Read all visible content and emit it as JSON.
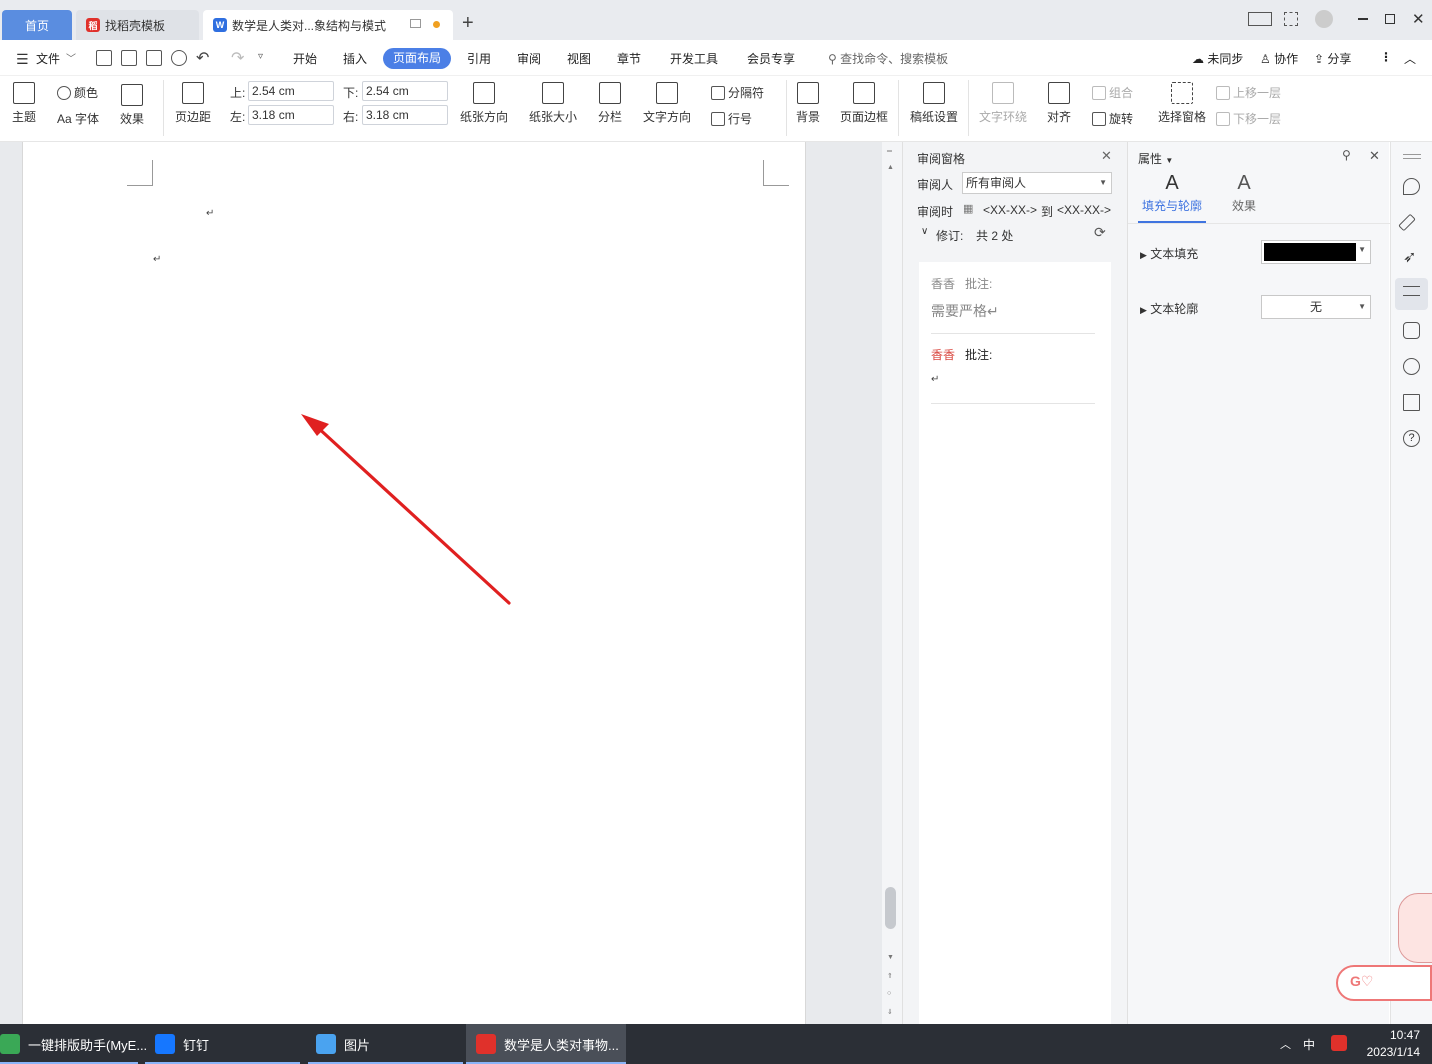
{
  "tabs": {
    "home": "首页",
    "template": "找稻壳模板",
    "document": "数学是人类对...象结构与模式",
    "add": "+"
  },
  "menu": {
    "file": "文件",
    "items": [
      "开始",
      "插入",
      "页面布局",
      "引用",
      "审阅",
      "视图",
      "章节",
      "开发工具",
      "会员专享"
    ],
    "active": "页面布局",
    "search_placeholder": "查找命令、搜索模板",
    "sync": "未同步",
    "collab": "协作",
    "share": "分享"
  },
  "ribbon": {
    "theme": "主题",
    "color": "颜色",
    "font": "Aa 字体",
    "effect": "效果",
    "margins": "页边距",
    "margin_top_label": "上:",
    "margin_top": "2.54 cm",
    "margin_bottom_label": "下:",
    "margin_bottom": "2.54 cm",
    "margin_left_label": "左:",
    "margin_left": "3.18 cm",
    "margin_right_label": "右:",
    "margin_right": "3.18 cm",
    "orientation": "纸张方向",
    "size": "纸张大小",
    "columns": "分栏",
    "text_direction": "文字方向",
    "breaks": "分隔符",
    "line_numbers": "行号",
    "background": "背景",
    "page_border": "页面边框",
    "manuscript": "稿纸设置",
    "text_wrap": "文字环绕",
    "align": "对齐",
    "group": "组合",
    "rotate": "旋转",
    "selection_pane": "选择窗格",
    "bring_forward": "上移一层",
    "send_backward": "下移一层"
  },
  "review_pane": {
    "title": "审阅窗格",
    "reviewer_label": "审阅人",
    "reviewer_value": "所有审阅人",
    "time_label": "审阅时",
    "time_from": "<XX-XX->",
    "time_to_label": "到",
    "time_to": "<XX-XX->",
    "revisions": "修订:",
    "revisions_count": "共 2 处",
    "comments": [
      {
        "author": "香香",
        "label": "批注:",
        "text": "需要严格↵"
      },
      {
        "author": "香香",
        "label": "批注:",
        "text": "↵"
      }
    ]
  },
  "prop_pane": {
    "title": "属性",
    "tab_fill": "填充与轮廓",
    "tab_effect": "效果",
    "text_fill": "文本填充",
    "text_outline": "文本轮廓",
    "outline_value": "无",
    "fill_color": "#000000"
  },
  "document": {
    "para_marks": [
      "↵",
      "↵"
    ]
  },
  "taskbar": {
    "items": [
      "一键排版助手(MyE...",
      "钉钉",
      "图片",
      "数学是人类对事物..."
    ],
    "ime": "中",
    "time": "10:47",
    "date": "2023/1/14"
  },
  "colors": {
    "accent": "#4b7fe6",
    "arrow": "#e02020",
    "comment_author_active": "#d9453d"
  }
}
